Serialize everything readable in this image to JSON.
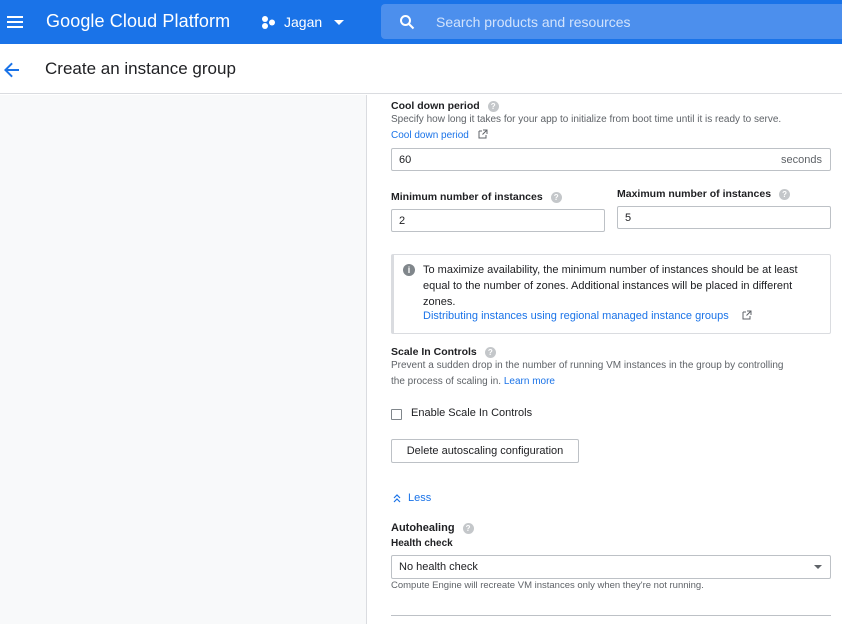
{
  "topbar": {
    "brand": "Google Cloud Platform",
    "project_name": "Jagan",
    "search_placeholder": "Search products and resources"
  },
  "header": {
    "title": "Create an instance group"
  },
  "form": {
    "cooldown": {
      "label": "Cool down period",
      "description": "Specify how long it takes for your app to initialize from boot time until it is ready to serve.",
      "link": "Cool down period",
      "value": "60",
      "suffix": "seconds"
    },
    "min_instances": {
      "label": "Minimum number of instances",
      "value": "2"
    },
    "max_instances": {
      "label": "Maximum number of instances",
      "value": "5"
    },
    "info": {
      "text": "To maximize availability, the minimum number of instances should be at least equal to the number of zones. Additional instances will be placed in different zones.",
      "link": "Distributing instances using regional managed instance groups"
    },
    "scale_in": {
      "label": "Scale In Controls",
      "description_line1": "Prevent a sudden drop in the number of running VM instances in the group by controlling",
      "description_line2": "the process of scaling in.",
      "learn_more": "Learn more",
      "checkbox_label": "Enable Scale In Controls"
    },
    "delete_button": "Delete autoscaling configuration",
    "less_label": "Less",
    "autohealing": {
      "label": "Autohealing",
      "health_check_label": "Health check",
      "health_check_value": "No health check",
      "note": "Compute Engine will recreate VM instances only when they're not running."
    }
  },
  "colors": {
    "topbar": "#1a73e8",
    "search_bg": "#4c8fed",
    "link": "#1a73e8",
    "left_panel": "#f8f9fa"
  }
}
